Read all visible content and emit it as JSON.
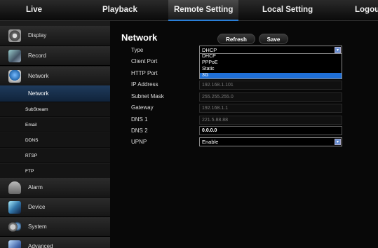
{
  "topnav": {
    "tabs": [
      "Live",
      "Playback",
      "Remote Setting",
      "Local Setting",
      "Logou"
    ]
  },
  "sidebar": {
    "categories": [
      {
        "label": "Display",
        "icon": "display-icon"
      },
      {
        "label": "Record",
        "icon": "record-icon"
      },
      {
        "label": "Network",
        "icon": "network-icon"
      },
      {
        "label": "Alarm",
        "icon": "alarm-icon"
      },
      {
        "label": "Device",
        "icon": "device-icon"
      },
      {
        "label": "System",
        "icon": "system-icon"
      },
      {
        "label": "Advanced",
        "icon": "advanced-icon"
      }
    ],
    "subitems": [
      "Network",
      "SubStream",
      "Email",
      "DDNS",
      "RTSP",
      "FTP"
    ],
    "active_subitem": "Network"
  },
  "main": {
    "title": "Network",
    "refresh_label": "Refresh",
    "save_label": "Save",
    "fields": {
      "type": {
        "label": "Type",
        "value": "DHCP"
      },
      "client_port": {
        "label": "Client Port"
      },
      "http_port": {
        "label": "HTTP Port"
      },
      "ip_address": {
        "label": "IP Address",
        "value": "192.168.1.101"
      },
      "subnet_mask": {
        "label": "Subnet Mask",
        "value": "255.255.255.0"
      },
      "gateway": {
        "label": "Gateway",
        "value": "192.168.1.1"
      },
      "dns1": {
        "label": "DNS 1",
        "value": "221.5.88.88"
      },
      "dns2": {
        "label": "DNS 2",
        "value": "0.0.0.0"
      },
      "upnp": {
        "label": "UPNP",
        "value": "Enable"
      }
    },
    "type_options": [
      "DHCP",
      "PPPoE",
      "Static",
      "3G"
    ],
    "type_highlighted": "3G"
  },
  "colors": {
    "accent": "#2a7fd8",
    "selection": "#1f6fd6",
    "active_sidebar": "#1f3b5c"
  }
}
